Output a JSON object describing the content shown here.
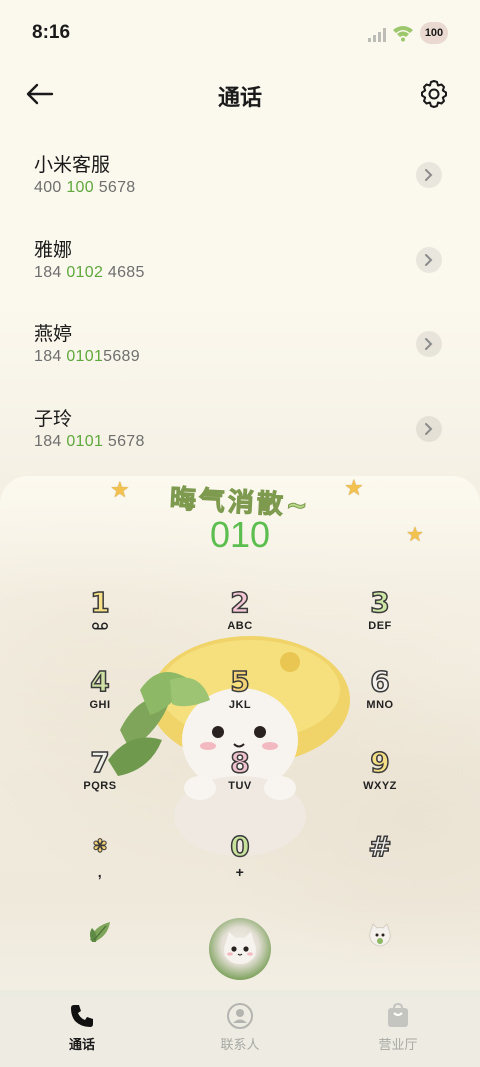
{
  "status_bar": {
    "time": "8:16",
    "battery": "100",
    "signal_icon": "cellular-signal-icon",
    "wifi_icon": "wifi-icon"
  },
  "header": {
    "title": "通话",
    "back_icon": "arrow-left-icon",
    "settings_icon": "gear-icon"
  },
  "contacts": [
    {
      "name": "小米客服",
      "number_parts": [
        "400 ",
        "100",
        " 5678"
      ]
    },
    {
      "name": "雅娜",
      "number_parts": [
        "184 ",
        "0102",
        " 4685"
      ]
    },
    {
      "name": "燕婷",
      "number_parts": [
        "184 ",
        "0101",
        "5689"
      ]
    },
    {
      "name": "子玲",
      "number_parts": [
        "184 ",
        "0101",
        " 5678"
      ]
    }
  ],
  "dialer": {
    "banner": "晦气消散~",
    "dialed_number": "010",
    "keys": [
      {
        "digit": "1",
        "letters": ""
      },
      {
        "digit": "2",
        "letters": "ABC"
      },
      {
        "digit": "3",
        "letters": "DEF"
      },
      {
        "digit": "4",
        "letters": "GHI"
      },
      {
        "digit": "5",
        "letters": "JKL"
      },
      {
        "digit": "6",
        "letters": "MNO"
      },
      {
        "digit": "7",
        "letters": "PQRS"
      },
      {
        "digit": "8",
        "letters": "TUV"
      },
      {
        "digit": "9",
        "letters": "WXYZ"
      },
      {
        "digit": "✽",
        "letters": ","
      },
      {
        "digit": "0",
        "letters": "+"
      },
      {
        "digit": "#",
        "letters": ""
      }
    ]
  },
  "bottom_nav": {
    "items": [
      {
        "label": "通话",
        "icon": "phone-icon",
        "active": true
      },
      {
        "label": "联系人",
        "icon": "person-icon",
        "active": false
      },
      {
        "label": "营业厅",
        "icon": "shopping-bag-icon",
        "active": false
      }
    ]
  },
  "colors": {
    "highlight_green": "#5fa83c",
    "dialed_green": "#5cbe4e",
    "background": "#fbf8ee"
  }
}
